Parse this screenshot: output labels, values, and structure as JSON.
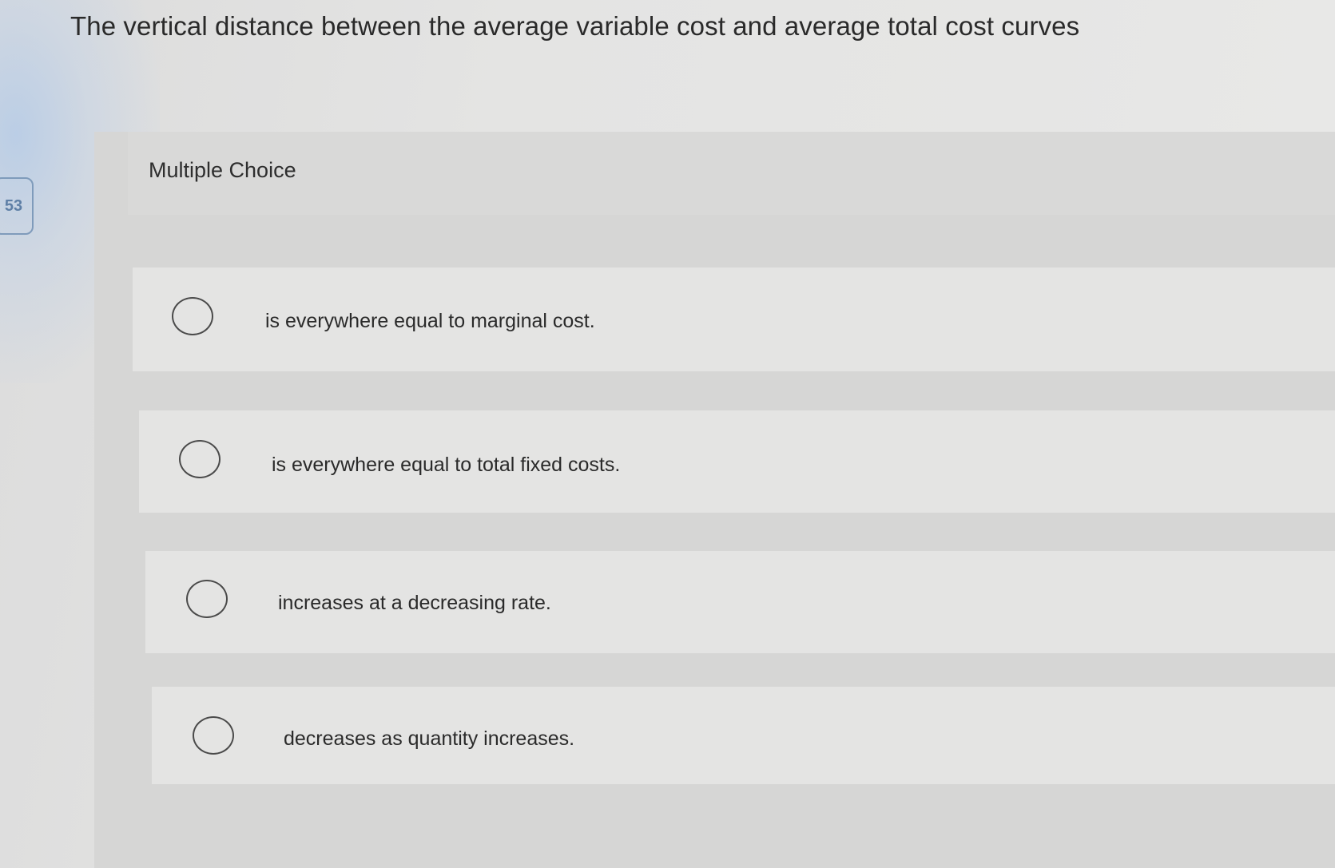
{
  "question": {
    "number": "53",
    "text": "The vertical distance between the average variable cost and average total cost curves"
  },
  "panel": {
    "title": "Multiple Choice"
  },
  "options": [
    {
      "label": "is everywhere equal to marginal cost.",
      "selected": false
    },
    {
      "label": "is everywhere equal to total fixed costs.",
      "selected": false
    },
    {
      "label": "increases at a decreasing rate.",
      "selected": false
    },
    {
      "label": "decreases as quantity increases.",
      "selected": false
    }
  ]
}
